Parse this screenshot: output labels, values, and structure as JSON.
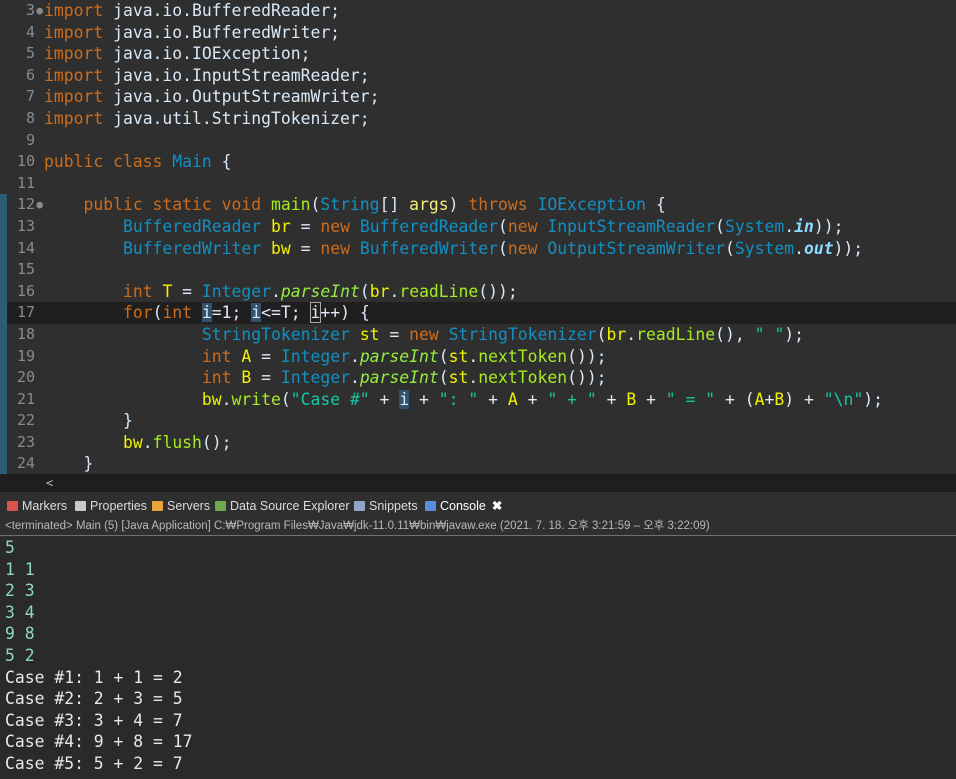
{
  "editor": {
    "lines": [
      {
        "num": "3",
        "fold": "●",
        "marker": false,
        "current": false
      },
      {
        "num": "4",
        "fold": "",
        "marker": false,
        "current": false
      },
      {
        "num": "5",
        "fold": "",
        "marker": false,
        "current": false
      },
      {
        "num": "6",
        "fold": "",
        "marker": false,
        "current": false
      },
      {
        "num": "7",
        "fold": "",
        "marker": false,
        "current": false
      },
      {
        "num": "8",
        "fold": "",
        "marker": false,
        "current": false
      },
      {
        "num": "9",
        "fold": "",
        "marker": false,
        "current": false
      },
      {
        "num": "10",
        "fold": "",
        "marker": false,
        "current": false
      },
      {
        "num": "11",
        "fold": "",
        "marker": false,
        "current": false
      },
      {
        "num": "12",
        "fold": "●",
        "marker": true,
        "current": false
      },
      {
        "num": "13",
        "fold": "",
        "marker": true,
        "current": false
      },
      {
        "num": "14",
        "fold": "",
        "marker": true,
        "current": false
      },
      {
        "num": "15",
        "fold": "",
        "marker": true,
        "current": false
      },
      {
        "num": "16",
        "fold": "",
        "marker": true,
        "current": false
      },
      {
        "num": "17",
        "fold": "",
        "marker": true,
        "current": true
      },
      {
        "num": "18",
        "fold": "",
        "marker": true,
        "current": false
      },
      {
        "num": "19",
        "fold": "",
        "marker": true,
        "current": false
      },
      {
        "num": "20",
        "fold": "",
        "marker": true,
        "current": false
      },
      {
        "num": "21",
        "fold": "",
        "marker": true,
        "current": false
      },
      {
        "num": "22",
        "fold": "",
        "marker": true,
        "current": false
      },
      {
        "num": "23",
        "fold": "",
        "marker": true,
        "current": false
      },
      {
        "num": "24",
        "fold": "",
        "marker": true,
        "current": false
      }
    ],
    "tokens": [
      [
        [
          "kw",
          "import"
        ],
        [
          "id",
          " java.io.BufferedReader;"
        ]
      ],
      [
        [
          "kw",
          "import"
        ],
        [
          "id",
          " java.io.BufferedWriter;"
        ]
      ],
      [
        [
          "kw",
          "import"
        ],
        [
          "id",
          " java.io.IOException;"
        ]
      ],
      [
        [
          "kw",
          "import"
        ],
        [
          "id",
          " java.io.InputStreamReader;"
        ]
      ],
      [
        [
          "kw",
          "import"
        ],
        [
          "id",
          " java.io.OutputStreamWriter;"
        ]
      ],
      [
        [
          "kw",
          "import"
        ],
        [
          "id",
          " java.util.StringTokenizer;"
        ]
      ],
      [],
      [
        [
          "kw",
          "public class "
        ],
        [
          "cls",
          "Main"
        ],
        [
          "id",
          " {"
        ]
      ],
      [],
      [
        [
          "id",
          "    "
        ],
        [
          "kw",
          "public static void "
        ],
        [
          "mth",
          "main"
        ],
        [
          "id",
          "("
        ],
        [
          "cls",
          "String"
        ],
        [
          "id",
          "[] "
        ],
        [
          "var",
          "args"
        ],
        [
          "id",
          ") "
        ],
        [
          "kw",
          "throws "
        ],
        [
          "cls",
          "IOException"
        ],
        [
          "id",
          " {"
        ]
      ],
      [
        [
          "id",
          "        "
        ],
        [
          "cls",
          "BufferedReader"
        ],
        [
          "id",
          " "
        ],
        [
          "lv",
          "br"
        ],
        [
          "op",
          " = "
        ],
        [
          "kw",
          "new "
        ],
        [
          "cls",
          "BufferedReader"
        ],
        [
          "id",
          "("
        ],
        [
          "kw",
          "new "
        ],
        [
          "cls",
          "InputStreamReader"
        ],
        [
          "id",
          "("
        ],
        [
          "cls",
          "System"
        ],
        [
          "id",
          "."
        ],
        [
          "fi",
          "in"
        ],
        [
          "id",
          "));"
        ]
      ],
      [
        [
          "id",
          "        "
        ],
        [
          "cls",
          "BufferedWriter"
        ],
        [
          "id",
          " "
        ],
        [
          "lv",
          "bw"
        ],
        [
          "op",
          " = "
        ],
        [
          "kw",
          "new "
        ],
        [
          "cls",
          "BufferedWriter"
        ],
        [
          "id",
          "("
        ],
        [
          "kw",
          "new "
        ],
        [
          "cls",
          "OutputStreamWriter"
        ],
        [
          "id",
          "("
        ],
        [
          "cls",
          "System"
        ],
        [
          "id",
          "."
        ],
        [
          "fi",
          "out"
        ],
        [
          "id",
          "));"
        ]
      ],
      [],
      [
        [
          "id",
          "        "
        ],
        [
          "kw",
          "int "
        ],
        [
          "lv",
          "T"
        ],
        [
          "op",
          " = "
        ],
        [
          "cls",
          "Integer"
        ],
        [
          "id",
          "."
        ],
        [
          "it",
          "parseInt"
        ],
        [
          "id",
          "("
        ],
        [
          "lv",
          "br"
        ],
        [
          "id",
          "."
        ],
        [
          "mth",
          "readLine"
        ],
        [
          "id",
          "());"
        ]
      ],
      [
        [
          "id",
          "        "
        ],
        [
          "kw",
          "for"
        ],
        [
          "id",
          "("
        ],
        [
          "kw",
          "int "
        ],
        [
          "hl",
          "i"
        ],
        [
          "op",
          "=1; "
        ],
        [
          "hl",
          "i"
        ],
        [
          "op",
          "<=T; "
        ],
        [
          "ob",
          "i"
        ],
        [
          "op",
          "++) {"
        ]
      ],
      [
        [
          "id",
          "                "
        ],
        [
          "cls",
          "StringTokenizer"
        ],
        [
          "id",
          " "
        ],
        [
          "lv",
          "st"
        ],
        [
          "op",
          " = "
        ],
        [
          "kw",
          "new "
        ],
        [
          "cls",
          "StringTokenizer"
        ],
        [
          "id",
          "("
        ],
        [
          "lv",
          "br"
        ],
        [
          "id",
          "."
        ],
        [
          "mth",
          "readLine"
        ],
        [
          "id",
          "(), "
        ],
        [
          "str",
          "\" \""
        ],
        [
          "id",
          ");"
        ]
      ],
      [
        [
          "id",
          "                "
        ],
        [
          "kw",
          "int "
        ],
        [
          "lv",
          "A"
        ],
        [
          "op",
          " = "
        ],
        [
          "cls",
          "Integer"
        ],
        [
          "id",
          "."
        ],
        [
          "it",
          "parseInt"
        ],
        [
          "id",
          "("
        ],
        [
          "lv",
          "st"
        ],
        [
          "id",
          "."
        ],
        [
          "mth",
          "nextToken"
        ],
        [
          "id",
          "());"
        ]
      ],
      [
        [
          "id",
          "                "
        ],
        [
          "kw",
          "int "
        ],
        [
          "lv",
          "B"
        ],
        [
          "op",
          " = "
        ],
        [
          "cls",
          "Integer"
        ],
        [
          "id",
          "."
        ],
        [
          "it",
          "parseInt"
        ],
        [
          "id",
          "("
        ],
        [
          "lv",
          "st"
        ],
        [
          "id",
          "."
        ],
        [
          "mth",
          "nextToken"
        ],
        [
          "id",
          "());"
        ]
      ],
      [
        [
          "id",
          "                "
        ],
        [
          "lv",
          "bw"
        ],
        [
          "id",
          "."
        ],
        [
          "mth",
          "write"
        ],
        [
          "id",
          "("
        ],
        [
          "str",
          "\"Case #\""
        ],
        [
          "op",
          " + "
        ],
        [
          "hl",
          "i"
        ],
        [
          "op",
          " + "
        ],
        [
          "str",
          "\": \""
        ],
        [
          "op",
          " + "
        ],
        [
          "lv",
          "A"
        ],
        [
          "op",
          " + "
        ],
        [
          "str",
          "\" + \""
        ],
        [
          "op",
          " + "
        ],
        [
          "lv",
          "B"
        ],
        [
          "op",
          " + "
        ],
        [
          "str",
          "\" = \""
        ],
        [
          "op",
          " + ("
        ],
        [
          "lv",
          "A"
        ],
        [
          "op",
          "+"
        ],
        [
          "lv",
          "B"
        ],
        [
          "op",
          ") + "
        ],
        [
          "str",
          "\"\\n\""
        ],
        [
          "id",
          ");"
        ]
      ],
      [
        [
          "id",
          "        }"
        ]
      ],
      [
        [
          "id",
          "        "
        ],
        [
          "lv",
          "bw"
        ],
        [
          "id",
          "."
        ],
        [
          "mth",
          "flush"
        ],
        [
          "id",
          "();"
        ]
      ],
      [
        [
          "id",
          "    }"
        ]
      ]
    ],
    "scroll_arrow": "<"
  },
  "console": {
    "tabs": [
      {
        "label": "Markers",
        "icon": "markers-icon",
        "color": "#d9534f"
      },
      {
        "label": "Properties",
        "icon": "properties-icon",
        "color": "#c9c9c9"
      },
      {
        "label": "Servers",
        "icon": "servers-icon",
        "color": "#e8a33b"
      },
      {
        "label": "Data Source Explorer",
        "icon": "data-source-icon",
        "color": "#6fa84f"
      },
      {
        "label": "Snippets",
        "icon": "snippets-icon",
        "color": "#8fa6c6"
      },
      {
        "label": "Console",
        "icon": "console-icon",
        "color": "#5a8fd8",
        "active": true
      }
    ],
    "close_glyph": "✖",
    "status": "<terminated> Main (5) [Java Application] C:₩Program Files₩Java₩jdk-11.0.11₩bin₩javaw.exe  (2021. 7. 18. 오후 3:21:59 – 오후 3:22:09)",
    "output": [
      {
        "text": "5",
        "input": true
      },
      {
        "text": "1 1",
        "input": true
      },
      {
        "text": "2 3",
        "input": true
      },
      {
        "text": "3 4",
        "input": true
      },
      {
        "text": "9 8",
        "input": true
      },
      {
        "text": "5 2",
        "input": true
      },
      {
        "text": "Case #1: 1 + 1 = 2",
        "input": false
      },
      {
        "text": "Case #2: 2 + 3 = 5",
        "input": false
      },
      {
        "text": "Case #3: 3 + 4 = 7",
        "input": false
      },
      {
        "text": "Case #4: 9 + 8 = 17",
        "input": false
      },
      {
        "text": "Case #5: 5 + 2 = 7",
        "input": false
      }
    ]
  }
}
